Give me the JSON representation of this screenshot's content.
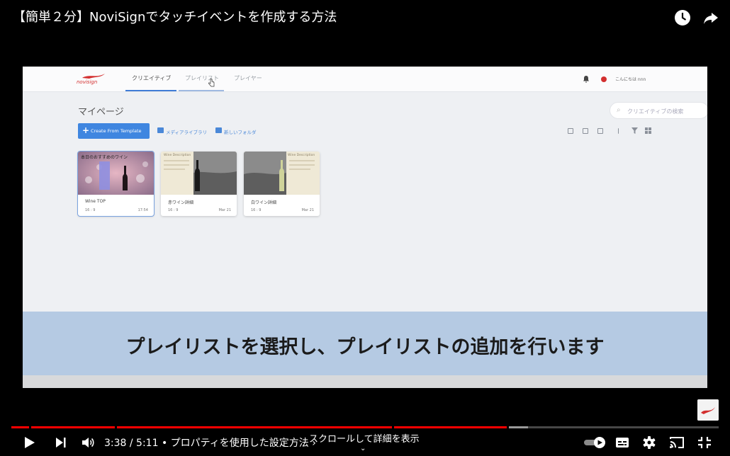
{
  "video": {
    "title": "【簡単２分】NoviSignでタッチイベントを作成する方法",
    "subtitle": "プレイリストを選択し、プレイリストの追加を行います"
  },
  "app": {
    "logo": "novisign",
    "nav_tabs": [
      "クリエイティブ",
      "プレイリスト",
      "プレイヤー"
    ],
    "active_tab": "クリエイティブ",
    "account_label": "こんにちは nnn",
    "page_heading": "マイページ",
    "search_placeholder": "クリエイティブの検索",
    "create_button": "Create From Template",
    "media_library_link": "メディアライブラリ",
    "new_folder_link": "新しいフォルダ",
    "cards": [
      {
        "name": "Wine TOP",
        "ratio": "16 : 9",
        "date": "17:54",
        "caption": "本日のおすすめのワイン"
      },
      {
        "name": "赤ワイン詳細",
        "ratio": "16 : 9",
        "date": "Mar 21",
        "caption": "Wine Description"
      },
      {
        "name": "白ワイン詳細",
        "ratio": "16 : 9",
        "date": "Mar 21",
        "caption": "Wine Description"
      }
    ]
  },
  "player": {
    "time": "3:38 / 5:11 • プロパティを使用した設定方法 ›",
    "scroll_hint": "スクロールして詳細を表示",
    "progress_fraction": 0.7,
    "buffer_fraction": 0.73,
    "chapter_marks_fraction": [
      0.025,
      0.146,
      0.538,
      0.7
    ],
    "accent_color": "#ff0000",
    "icons": [
      "play-icon",
      "next-icon",
      "volume-icon",
      "autoplay-toggle",
      "captions-icon",
      "settings-icon",
      "cast-icon",
      "exit-fullscreen-icon"
    ]
  }
}
